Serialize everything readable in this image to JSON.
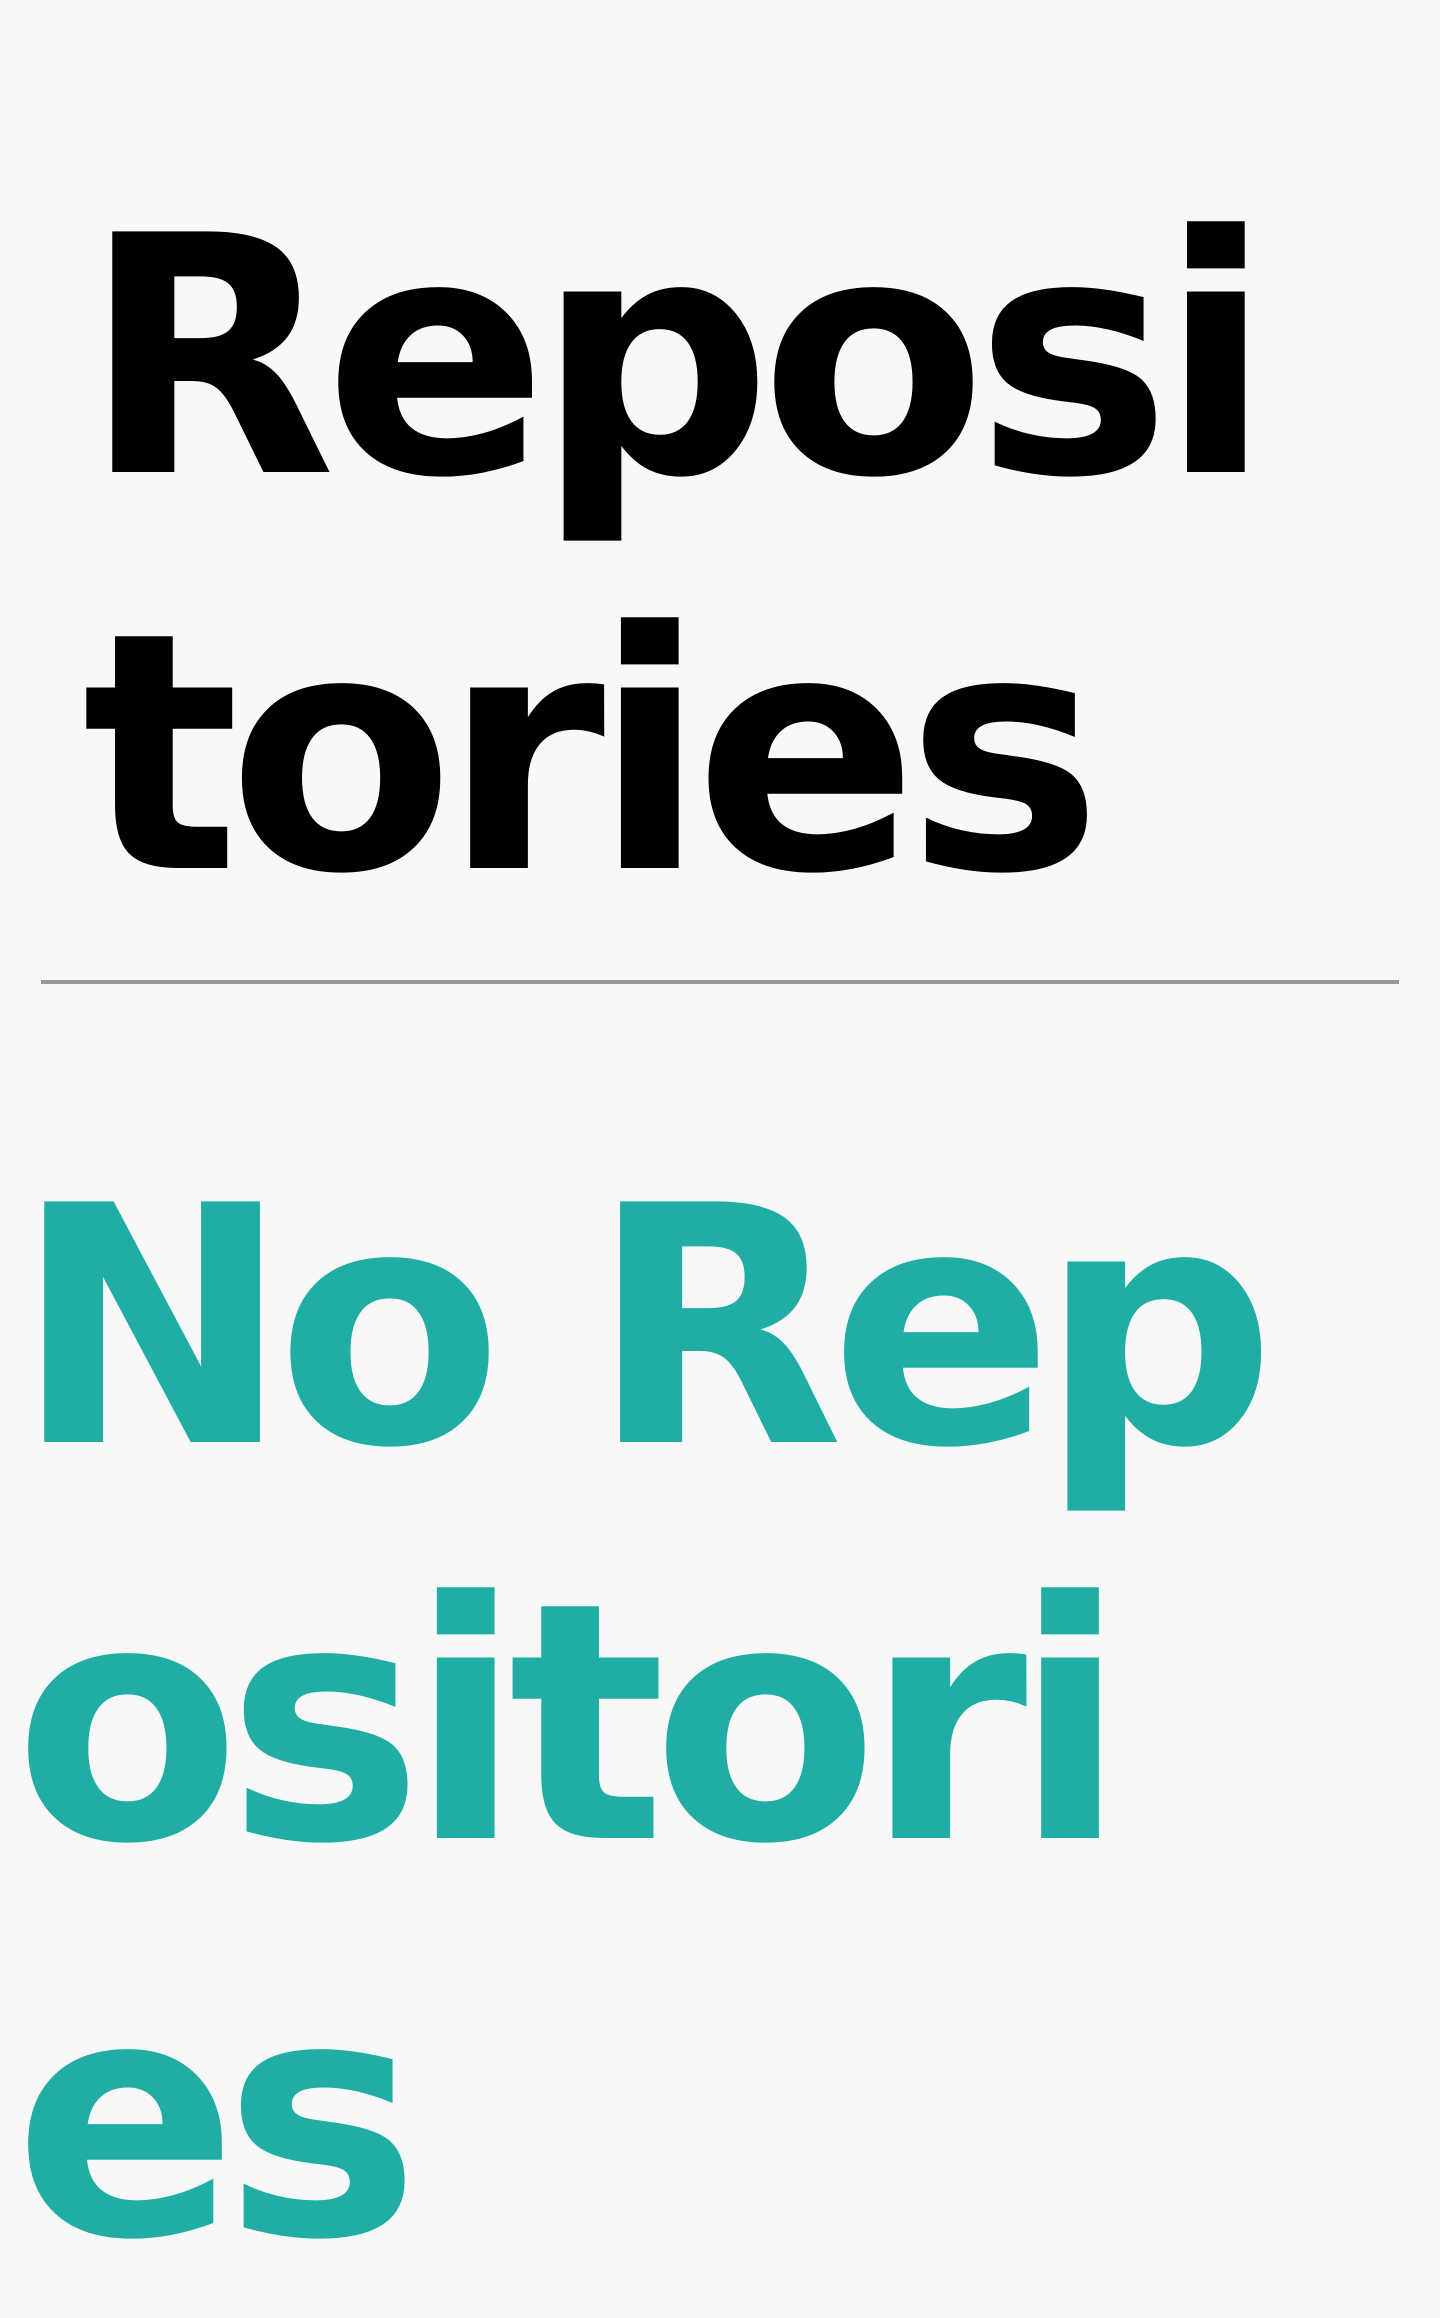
{
  "header": {
    "title": "Repositories"
  },
  "empty_state": {
    "message": "No Repositories"
  },
  "colors": {
    "background": "#f8f8f8",
    "title": "#000000",
    "divider": "#999999",
    "accent": "#20ada5"
  }
}
